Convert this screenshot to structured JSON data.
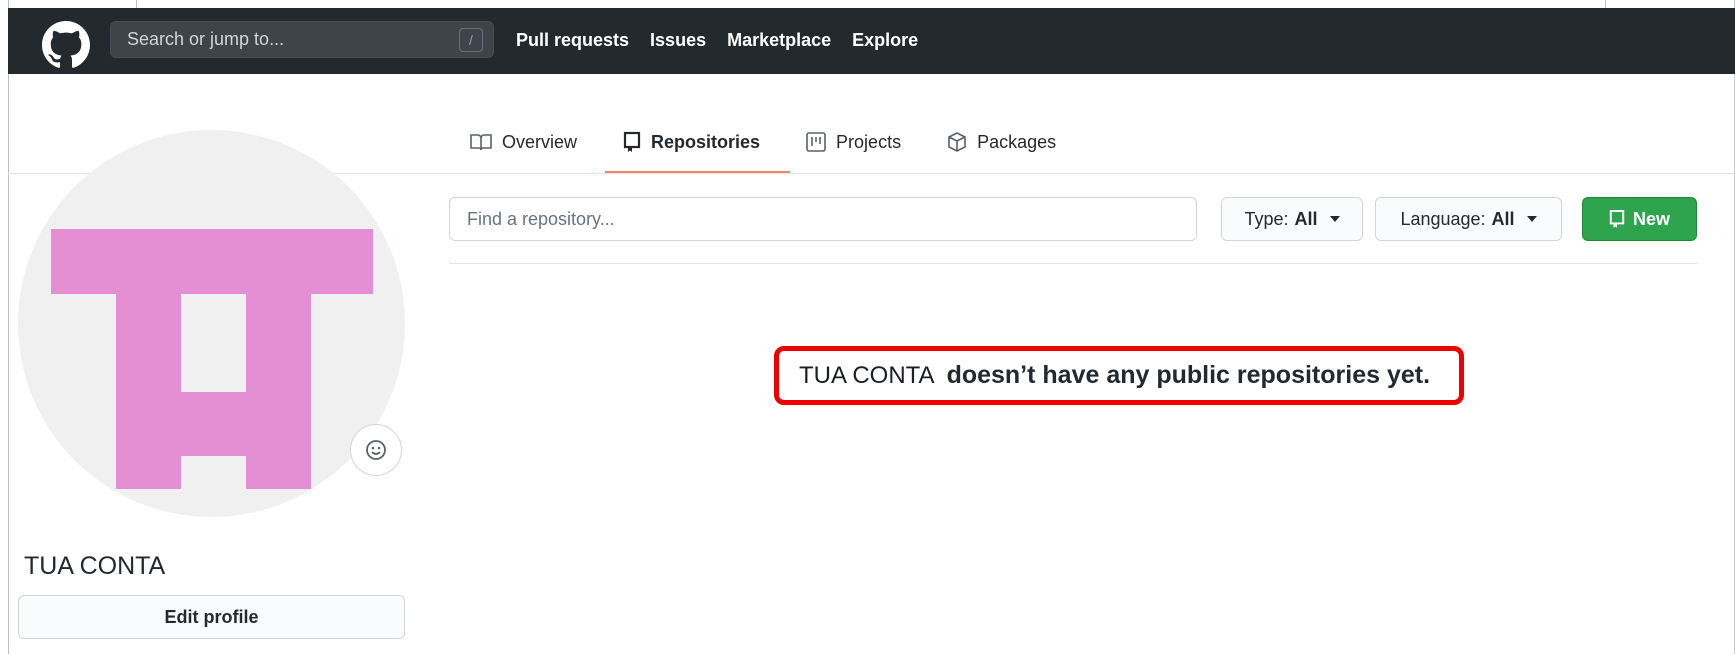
{
  "header": {
    "search_placeholder": "Search or jump to...",
    "search_shortcut": "/",
    "nav": [
      "Pull requests",
      "Issues",
      "Marketplace",
      "Explore"
    ]
  },
  "tabs": [
    {
      "label": "Overview",
      "icon": "book-icon"
    },
    {
      "label": "Repositories",
      "icon": "repo-icon",
      "active": true
    },
    {
      "label": "Projects",
      "icon": "project-icon"
    },
    {
      "label": "Packages",
      "icon": "package-icon"
    }
  ],
  "profile": {
    "name": "TUA CONTA",
    "edit_label": "Edit profile",
    "avatar_color": "#e48fd3"
  },
  "repos": {
    "find_placeholder": "Find a repository...",
    "type_label": "Type:",
    "type_value": "All",
    "language_label": "Language:",
    "language_value": "All",
    "new_label": "New",
    "empty_user": "TUA CONTA",
    "empty_text": "doesn’t have any public repositories yet."
  },
  "colors": {
    "header_bg": "#24292e",
    "accent_tab": "#f9826c",
    "new_button": "#2ea44f",
    "highlight": "#ee0000"
  }
}
